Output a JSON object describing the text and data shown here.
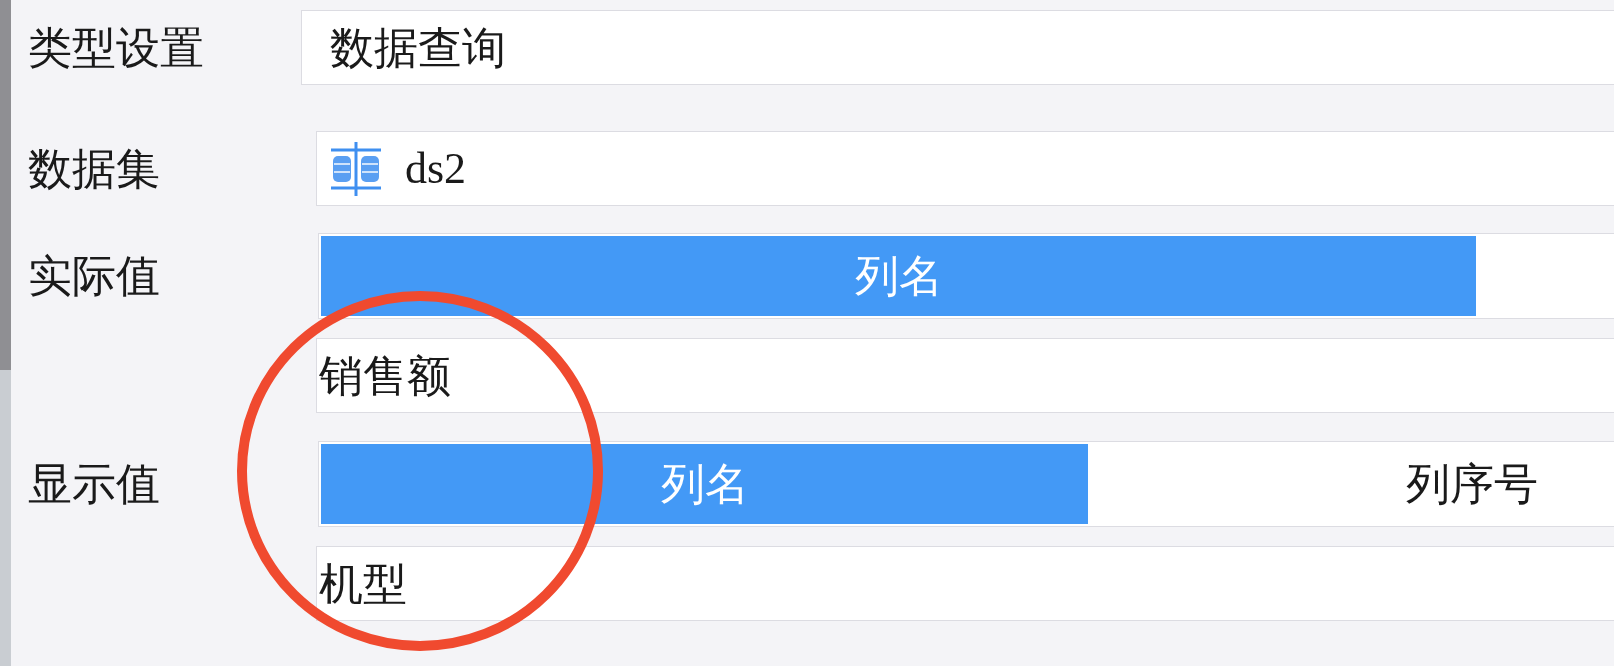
{
  "rows": [
    {
      "label": "类型设置",
      "kind": "text",
      "value": "数据查询"
    },
    {
      "label": "数据集",
      "kind": "dataset",
      "value": "ds2"
    },
    {
      "label": "实际值",
      "kind": "column",
      "tabs": [
        {
          "label": "列名",
          "selected": true
        }
      ],
      "value": "销售额"
    },
    {
      "label": "显示值",
      "kind": "column",
      "tabs": [
        {
          "label": "列名",
          "selected": true
        },
        {
          "label": "列序号",
          "selected": false
        }
      ],
      "value": "机型"
    }
  ],
  "annotation": {
    "kind": "circle",
    "color": "#f04a2f"
  }
}
